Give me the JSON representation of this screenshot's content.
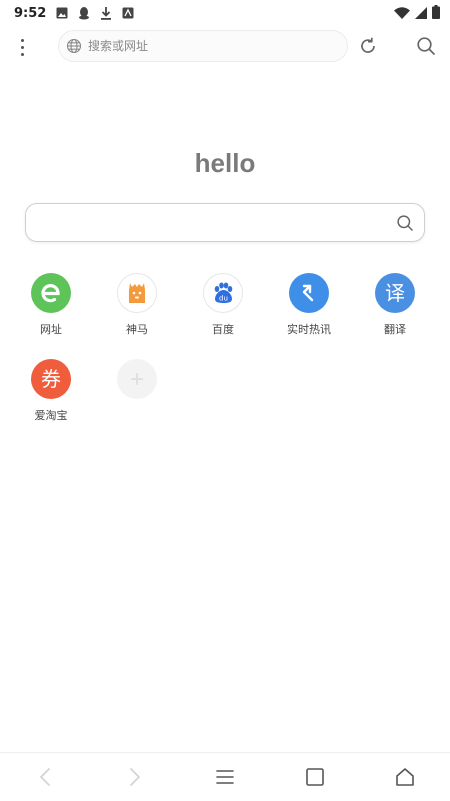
{
  "status_bar": {
    "time": "9:52",
    "left_icons": [
      "image-icon",
      "qq-penguin-icon",
      "download-icon",
      "app-notification-icon"
    ],
    "right_icons": [
      "wifi-icon",
      "signal-icon",
      "battery-icon"
    ]
  },
  "toolbar": {
    "url_placeholder": "搜索或网址",
    "icons": [
      "menu-dots-icon",
      "globe-icon",
      "refresh-icon",
      "search-icon"
    ]
  },
  "home": {
    "greeting": "hello",
    "search_placeholder": ""
  },
  "shortcuts": [
    {
      "label": "网址",
      "icon": "e-browser-icon",
      "color": "#5ec45a"
    },
    {
      "label": "神马",
      "icon": "shenma-alpaca-icon",
      "color": "#f39a3c"
    },
    {
      "label": "百度",
      "icon": "baidu-paw-icon",
      "color": "#2f6fe0"
    },
    {
      "label": "实时热讯",
      "icon": "arrow-pointer-icon",
      "color": "#3f8fe8"
    },
    {
      "label": "翻译",
      "icon": "translate-icon",
      "glyph": "译",
      "color": "#4a90e2"
    },
    {
      "label": "爱淘宝",
      "icon": "coupon-icon",
      "glyph": "券",
      "color": "#f05d3d"
    },
    {
      "label": "",
      "icon": "add-shortcut-icon",
      "color": "#e8e8e8"
    }
  ],
  "bottom_nav": {
    "icons": [
      "back-icon",
      "forward-icon",
      "menu-icon",
      "tabs-icon",
      "home-icon"
    ]
  }
}
